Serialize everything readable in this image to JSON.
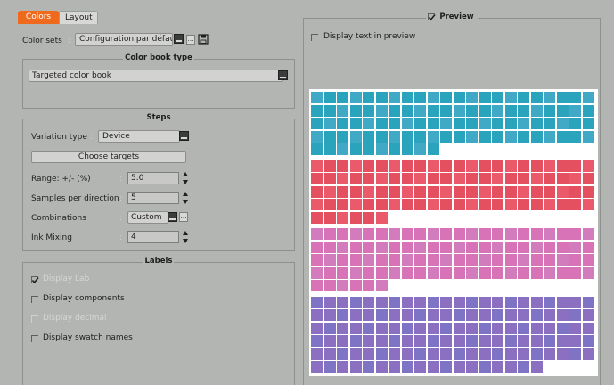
{
  "tabs": [
    {
      "label": "Colors",
      "active": true
    },
    {
      "label": "Layout",
      "active": false
    }
  ],
  "color_sets": {
    "label": "Color sets",
    "value": "Configuration par défau"
  },
  "color_book_type": {
    "legend": "Color book type",
    "value": "Targeted color book"
  },
  "steps": {
    "legend": "Steps",
    "variation_type": {
      "label": "Variation type",
      "value": "Device"
    },
    "choose_targets_label": "Choose targets",
    "range": {
      "label": "Range: +/- (%)",
      "value": "5.0"
    },
    "samples": {
      "label": "Samples per direction",
      "value": "5"
    },
    "combinations": {
      "label": "Combinations",
      "value": "Custom"
    },
    "ink_mixing": {
      "label": "Ink Mixing",
      "value": "4"
    }
  },
  "labels": {
    "legend": "Labels",
    "display_lab": {
      "label": "Display Lab",
      "checked": true,
      "enabled": false
    },
    "display_components": {
      "label": "Display components",
      "checked": false,
      "enabled": true
    },
    "display_decimal": {
      "label": "Display decimal",
      "checked": false,
      "enabled": false
    },
    "display_swatch_names": {
      "label": "Display swatch names",
      "checked": false,
      "enabled": true
    }
  },
  "preview": {
    "legend": "Preview",
    "legend_checked": true,
    "display_text": {
      "label": "Display text in preview",
      "checked": false
    },
    "swatch_groups": [
      {
        "name": "teal",
        "base": "#2aa3bd",
        "alt": "#3fa9c6",
        "count": 98
      },
      {
        "name": "red",
        "base": "#e4505f",
        "alt": "#ea5a6a",
        "count": 94
      },
      {
        "name": "pink",
        "base": "#d873b8",
        "alt": "#d27cbe",
        "count": 94
      },
      {
        "name": "violet",
        "base": "#8b6fc0",
        "alt": "#7f73c6",
        "count": 128
      }
    ],
    "colors": {
      "panel_bg": "#ffffff",
      "accent": "#f06a1e"
    }
  }
}
